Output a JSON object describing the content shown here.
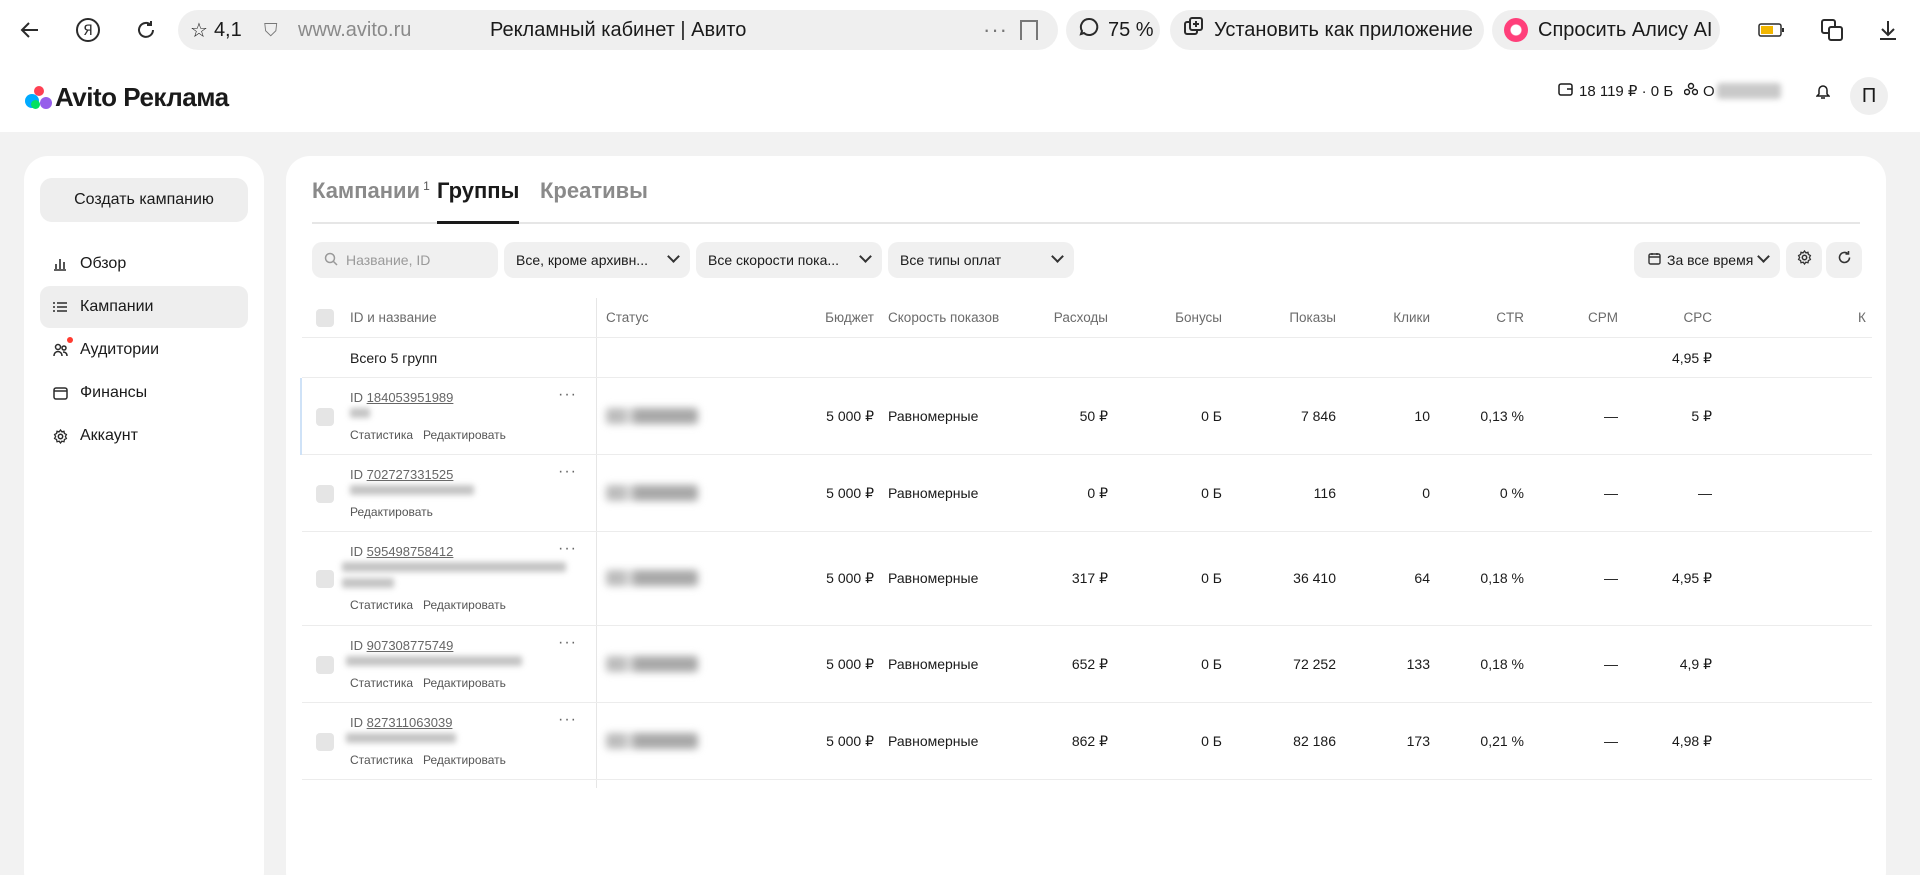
{
  "browser": {
    "rating": "4,1",
    "url": "www.avito.ru",
    "page_title": "Рекламный кабинет | Авито",
    "zoom": "75 %",
    "install_label": "Установить как приложение",
    "alice_label": "Спросить Алису AI"
  },
  "header": {
    "logo_text": "Avito Реклама",
    "balance": "18 119 ₽ · 0 Б",
    "org_prefix": "О",
    "avatar_letter": "П"
  },
  "sidebar": {
    "create_label": "Создать кампанию",
    "items": [
      {
        "label": "Обзор",
        "icon": "chart-icon"
      },
      {
        "label": "Кампании",
        "icon": "list-icon"
      },
      {
        "label": "Аудитории",
        "icon": "users-icon"
      },
      {
        "label": "Финансы",
        "icon": "wallet-icon"
      },
      {
        "label": "Аккаунт",
        "icon": "gear-icon"
      }
    ]
  },
  "tabs": {
    "campaigns": "Кампании",
    "campaigns_count": "1",
    "groups": "Группы",
    "creatives": "Креативы"
  },
  "filters": {
    "search_placeholder": "Название, ID",
    "status_filter": "Все, кроме архивн...",
    "speed_filter": "Все скорости пока...",
    "payment_filter": "Все типы оплат",
    "period": "За все время"
  },
  "table": {
    "headers": {
      "id_name": "ID и название",
      "status": "Статус",
      "budget": "Бюджет",
      "speed": "Скорость показов",
      "spend": "Расходы",
      "bonus": "Бонусы",
      "impressions": "Показы",
      "clicks": "Клики",
      "ctr": "CTR",
      "cpm": "CPM",
      "cpc": "CPC",
      "more": "К"
    },
    "total": {
      "label": "Всего 5 групп",
      "cpc": "4,95 ₽"
    },
    "actions": {
      "stats": "Статистика",
      "edit": "Редактировать"
    },
    "id_prefix": "ID",
    "rows": [
      {
        "id": "184053951989",
        "budget": "5 000 ₽",
        "speed": "Равномерные",
        "spend": "50 ₽",
        "bonus": "0 Б",
        "impressions": "7 846",
        "clicks": "10",
        "ctr": "0,13 %",
        "cpm": "—",
        "cpc": "5 ₽",
        "has_stats": true
      },
      {
        "id": "702727331525",
        "budget": "5 000 ₽",
        "speed": "Равномерные",
        "spend": "0 ₽",
        "bonus": "0 Б",
        "impressions": "116",
        "clicks": "0",
        "ctr": "0 %",
        "cpm": "—",
        "cpc": "—",
        "has_stats": false
      },
      {
        "id": "595498758412",
        "budget": "5 000 ₽",
        "speed": "Равномерные",
        "spend": "317 ₽",
        "bonus": "0 Б",
        "impressions": "36 410",
        "clicks": "64",
        "ctr": "0,18 %",
        "cpm": "—",
        "cpc": "4,95 ₽",
        "has_stats": true
      },
      {
        "id": "907308775749",
        "budget": "5 000 ₽",
        "speed": "Равномерные",
        "spend": "652 ₽",
        "bonus": "0 Б",
        "impressions": "72 252",
        "clicks": "133",
        "ctr": "0,18 %",
        "cpm": "—",
        "cpc": "4,9 ₽",
        "has_stats": true
      },
      {
        "id": "827311063039",
        "budget": "5 000 ₽",
        "speed": "Равномерные",
        "spend": "862 ₽",
        "bonus": "0 Б",
        "impressions": "82 186",
        "clicks": "173",
        "ctr": "0,21 %",
        "cpm": "—",
        "cpc": "4,98 ₽",
        "has_stats": true
      }
    ]
  }
}
